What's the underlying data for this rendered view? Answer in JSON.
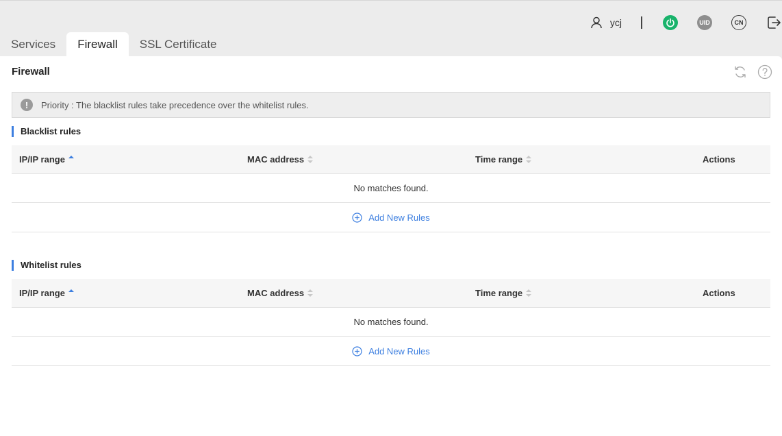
{
  "header": {
    "username": "ycj",
    "uid_label": "UID",
    "lang_label": "CN"
  },
  "tabs": [
    {
      "label": "Services"
    },
    {
      "label": "Firewall"
    },
    {
      "label": "SSL Certificate"
    }
  ],
  "panel": {
    "title": "Firewall",
    "notice": "Priority : The blacklist rules take precedence over the whitelist rules."
  },
  "blacklist": {
    "title": "Blacklist rules",
    "columns": [
      "IP/IP range",
      "MAC address",
      "Time range",
      "Actions"
    ],
    "empty_text": "No matches found.",
    "add_label": "Add New Rules"
  },
  "whitelist": {
    "title": "Whitelist rules",
    "columns": [
      "IP/IP range",
      "MAC address",
      "Time range",
      "Actions"
    ],
    "empty_text": "No matches found.",
    "add_label": "Add New Rules"
  },
  "colors": {
    "accent": "#3d7fe0",
    "power": "#19b36b"
  }
}
